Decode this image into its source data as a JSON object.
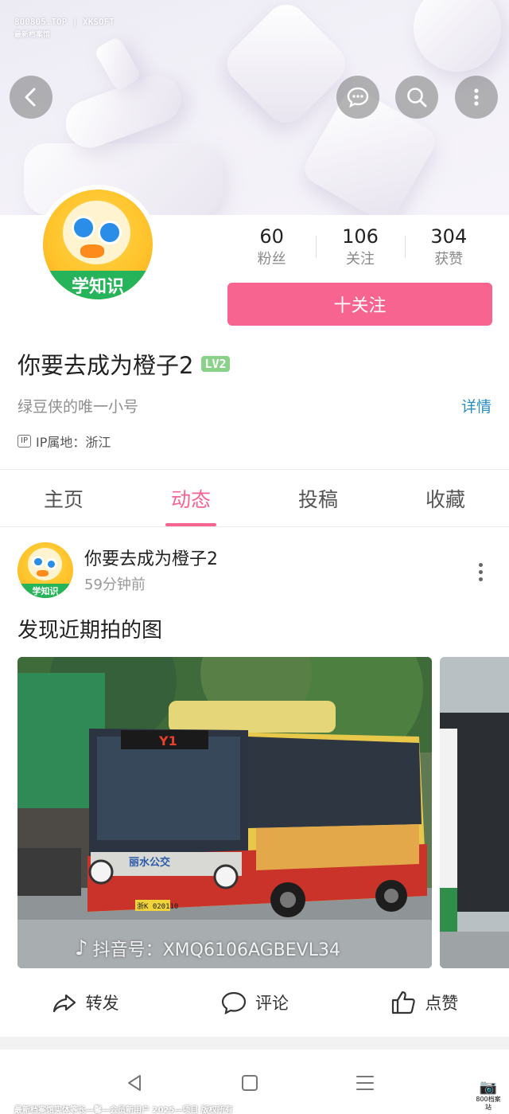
{
  "watermark": {
    "top_line1": "800805.TOP | XKSOFT",
    "top_line2": "最新档案馆",
    "bottom": "最新档案馆实体等长—馨—会员新用户 2025—项目 版权所有",
    "logo_text": "800档案站"
  },
  "header": {
    "icons": [
      "back-icon",
      "message-icon",
      "search-icon",
      "more-icon"
    ]
  },
  "profile": {
    "avatar_band_text": "学知识",
    "stats": [
      {
        "value": "60",
        "label": "粉丝"
      },
      {
        "value": "106",
        "label": "关注"
      },
      {
        "value": "304",
        "label": "获赞"
      }
    ],
    "follow_label": "十关注",
    "username": "你要去成为橙子2",
    "level": "LV2",
    "bio": "绿豆侠的唯一小号",
    "detail_label": "详情",
    "ip_tag": "IP",
    "ip_location": "IP属地：浙江"
  },
  "tabs": [
    {
      "label": "主页",
      "active": false
    },
    {
      "label": "动态",
      "active": true
    },
    {
      "label": "投稿",
      "active": false
    },
    {
      "label": "收藏",
      "active": false
    }
  ],
  "post": {
    "author": "你要去成为橙子2",
    "time": "59分钟前",
    "text": "发现近期拍的图",
    "avatar_band_text": "学知识",
    "photo_watermark_icon": "♪",
    "photo_watermark": "抖音号：XMQ6106AGBEVL34",
    "bus_route": "Y1",
    "bus_plate": "浙K 020110",
    "bus_side_text": "丽水公交"
  },
  "actions": [
    {
      "label": "转发",
      "icon": "share-icon"
    },
    {
      "label": "评论",
      "icon": "comment-icon"
    },
    {
      "label": "点赞",
      "icon": "like-icon"
    }
  ],
  "colors": {
    "accent": "#f6648f",
    "link": "#2a8cc4",
    "level_badge": "#8ad28a"
  }
}
